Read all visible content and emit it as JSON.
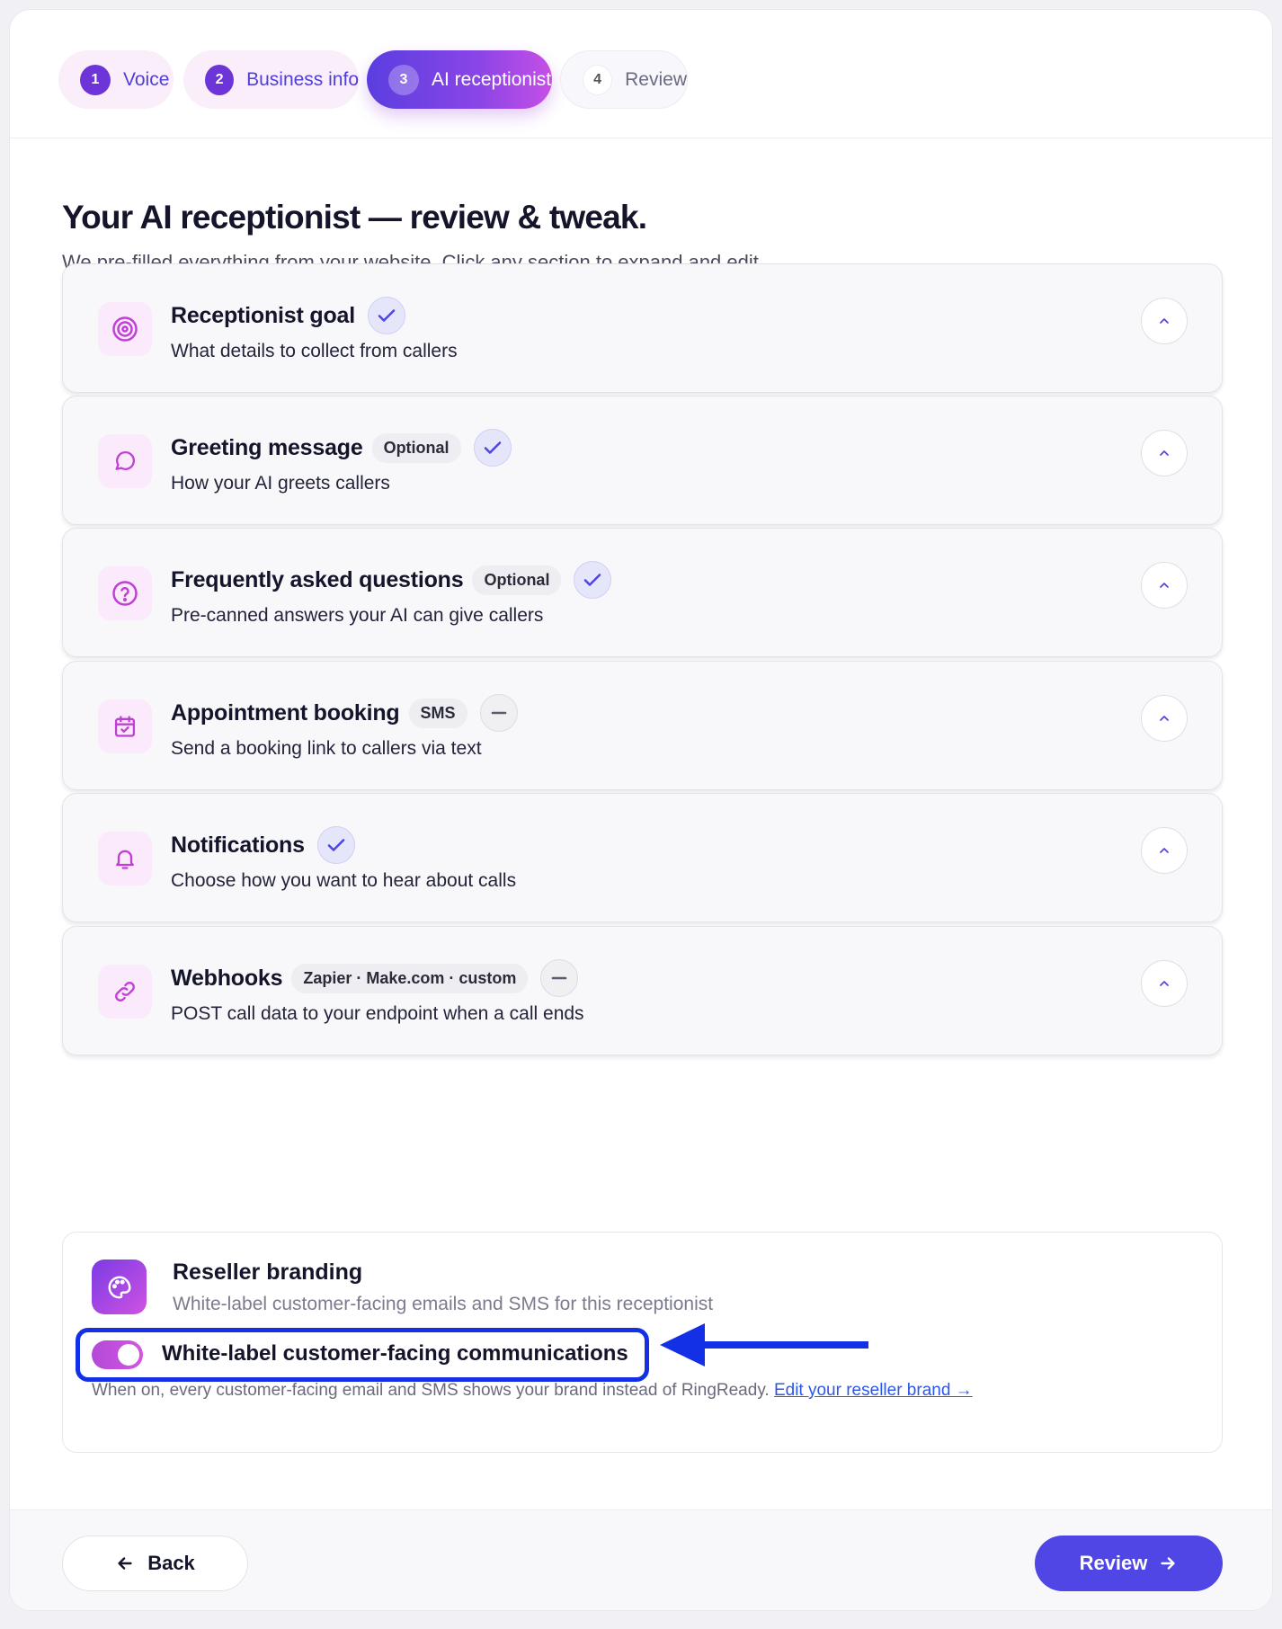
{
  "stepper": {
    "steps": [
      {
        "num": "1",
        "label": "Voice",
        "state": "done"
      },
      {
        "num": "2",
        "label": "Business info",
        "state": "done"
      },
      {
        "num": "3",
        "label": "AI receptionist",
        "state": "active"
      },
      {
        "num": "4",
        "label": "Review",
        "state": "todo"
      }
    ]
  },
  "page": {
    "title": "Your AI receptionist — review & tweak.",
    "subtitle": "We pre-filled everything from your website. Click any section to expand and edit."
  },
  "sections": [
    {
      "title": "Receptionist goal",
      "badge": "",
      "status": "complete",
      "description": "What details to collect from callers",
      "icon": "target-icon"
    },
    {
      "title": "Greeting message",
      "badge": "Optional",
      "status": "complete",
      "description": "How your AI greets callers",
      "icon": "chat-bubble-icon"
    },
    {
      "title": "Frequently asked questions",
      "badge": "Optional",
      "status": "complete",
      "description": "Pre-canned answers your AI can give callers",
      "icon": "question-circle-icon"
    },
    {
      "title": "Appointment booking",
      "badge": "SMS",
      "status": "off",
      "description": "Send a booking link to callers via text",
      "icon": "calendar-check-icon"
    },
    {
      "title": "Notifications",
      "badge": "",
      "status": "complete",
      "description": "Choose how you want to hear about calls",
      "icon": "bell-icon"
    },
    {
      "title": "Webhooks",
      "badge": "Zapier · Make.com · custom",
      "status": "off",
      "description": "POST call data to your endpoint when a call ends",
      "icon": "link-icon"
    }
  ],
  "reseller": {
    "title": "Reseller branding",
    "subtitle": "White-label customer-facing emails and SMS for this receptionist",
    "toggle_label": "White-label customer-facing communications",
    "toggle_on": true,
    "note": "When on, every customer-facing email and SMS shows your brand instead of RingReady.",
    "link": "Edit your reseller brand →",
    "icon": "palette-icon"
  },
  "footer": {
    "back_label": "Back",
    "review_label": "Review"
  },
  "colors": {
    "accent": "#4f46e5",
    "gradient_start": "#5a3ee0",
    "gradient_end": "#c64fe6",
    "annotation": "#1330e6"
  }
}
